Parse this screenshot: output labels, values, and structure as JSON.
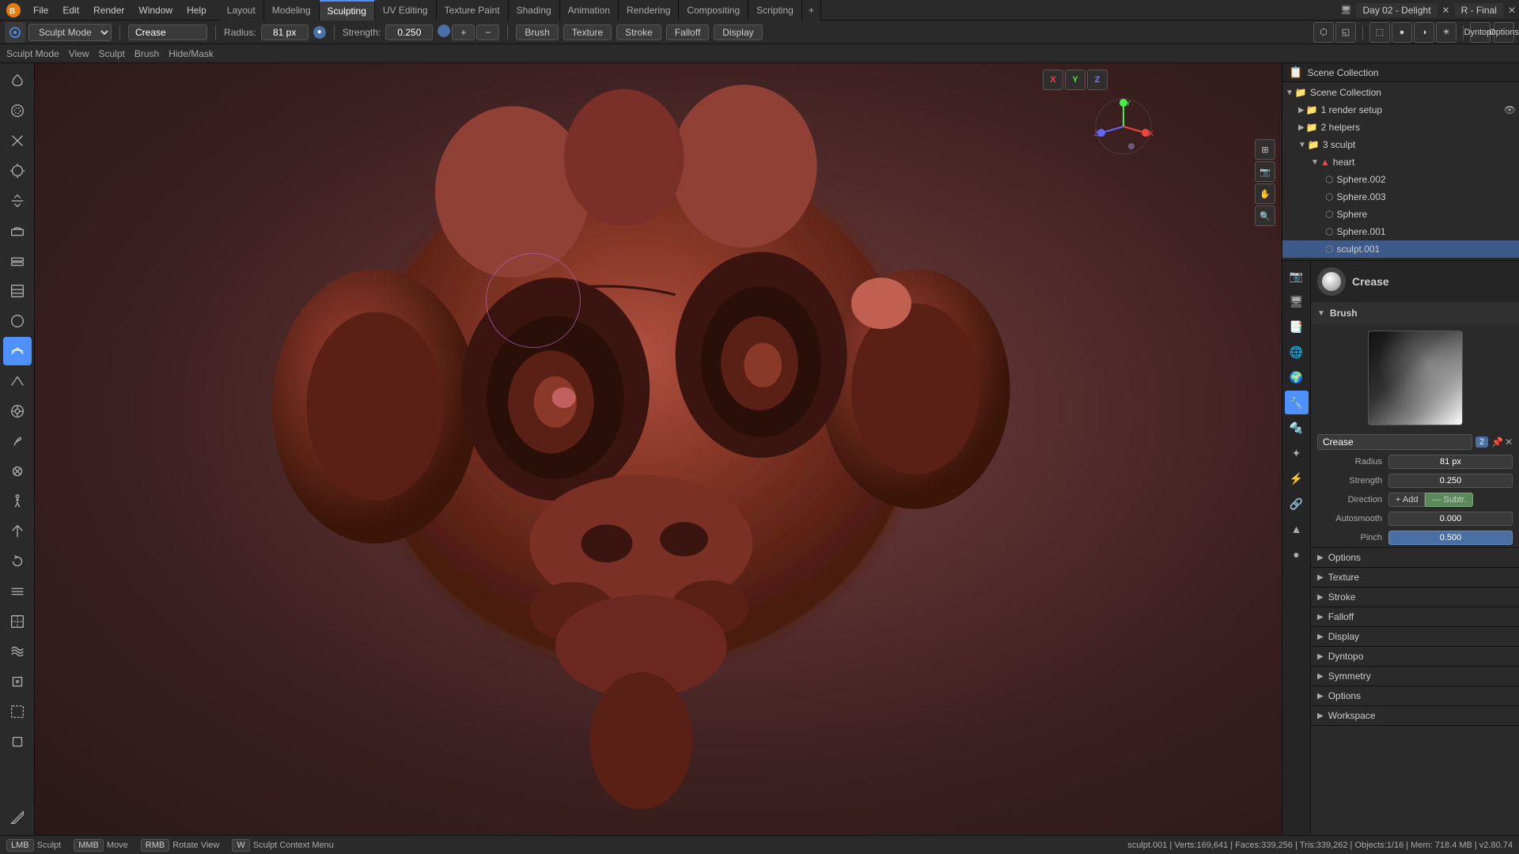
{
  "app": {
    "title": "Blender",
    "file": "Day 02 - Delight",
    "scene": "R - Final"
  },
  "menu": {
    "items": [
      "File",
      "Edit",
      "Render",
      "Window",
      "Help"
    ]
  },
  "workspaces": {
    "tabs": [
      "Layout",
      "Modeling",
      "Sculpting",
      "UV Editing",
      "Texture Paint",
      "Shading",
      "Animation",
      "Rendering",
      "Compositing",
      "Scripting"
    ],
    "active": "Sculpting"
  },
  "toolbar": {
    "mode": "Sculpt Mode",
    "brush_name": "Crease",
    "radius_label": "Radius:",
    "radius_value": "81 px",
    "strength_label": "Strength:",
    "strength_value": "0.250",
    "brush_btn": "Brush",
    "texture_btn": "Texture",
    "stroke_btn": "Stroke",
    "falloff_btn": "Falloff",
    "display_btn": "Display"
  },
  "sub_menu": {
    "items": [
      "Sculpt Mode",
      "View",
      "Sculpt",
      "Brush",
      "Hide/Mask"
    ]
  },
  "tools": [
    {
      "name": "grab",
      "icon": "↗",
      "title": "Draw"
    },
    {
      "name": "smooth",
      "icon": "⊙",
      "title": "Smooth"
    },
    {
      "name": "pinch",
      "icon": "✦",
      "title": "Pinch"
    },
    {
      "name": "inflate",
      "icon": "◎",
      "title": "Inflate"
    },
    {
      "name": "flatten",
      "icon": "⬡",
      "title": "Flatten"
    },
    {
      "name": "clay",
      "icon": "▣",
      "title": "Clay"
    },
    {
      "name": "clay-strips",
      "icon": "▤",
      "title": "Clay Strips"
    },
    {
      "name": "layer",
      "icon": "⬛",
      "title": "Layer"
    },
    {
      "name": "blob",
      "icon": "●",
      "title": "Blob"
    },
    {
      "name": "crease-tool",
      "icon": "⌒",
      "title": "Crease",
      "active": true
    },
    {
      "name": "draw-sharp",
      "icon": "△",
      "title": "Draw Sharp"
    },
    {
      "name": "elastic",
      "icon": "⊕",
      "title": "Elastic"
    },
    {
      "name": "snake-hook",
      "icon": "⤷",
      "title": "Snake Hook"
    },
    {
      "name": "thumb",
      "icon": "◐",
      "title": "Thumb"
    },
    {
      "name": "pose",
      "icon": "✋",
      "title": "Pose"
    },
    {
      "name": "nudge",
      "icon": "➤",
      "title": "Nudge"
    },
    {
      "name": "rotate-tool",
      "icon": "↺",
      "title": "Rotate"
    },
    {
      "name": "slide-relax",
      "icon": "≋",
      "title": "Slide Relax"
    },
    {
      "name": "boundary",
      "icon": "⊟",
      "title": "Boundary"
    },
    {
      "name": "cloth",
      "icon": "≈",
      "title": "Cloth"
    },
    {
      "name": "simplify",
      "icon": "◇",
      "title": "Simplify"
    },
    {
      "name": "mask-tool",
      "icon": "◩",
      "title": "Mask"
    },
    {
      "name": "box-mask",
      "icon": "▭",
      "title": "Box Mask"
    },
    {
      "name": "annotate",
      "icon": "✏",
      "title": "Annotate"
    }
  ],
  "outliner": {
    "title": "Scene Collection",
    "items": [
      {
        "id": "scene-collection",
        "label": "Scene Collection",
        "indent": 0,
        "expanded": true,
        "icon": "📁"
      },
      {
        "id": "render-setup",
        "label": "1 render setup",
        "indent": 1,
        "expanded": false,
        "icon": "📁"
      },
      {
        "id": "helpers",
        "label": "2 helpers",
        "indent": 1,
        "expanded": false,
        "icon": "📁"
      },
      {
        "id": "sculpt",
        "label": "3 sculpt",
        "indent": 1,
        "expanded": true,
        "icon": "📁"
      },
      {
        "id": "heart",
        "label": "heart",
        "indent": 2,
        "expanded": true,
        "icon": "🔺"
      },
      {
        "id": "sphere-002",
        "label": "Sphere.002",
        "indent": 3,
        "expanded": false,
        "icon": "⬡"
      },
      {
        "id": "sphere-003",
        "label": "Sphere.003",
        "indent": 3,
        "expanded": false,
        "icon": "⬡"
      },
      {
        "id": "sphere",
        "label": "Sphere",
        "indent": 3,
        "expanded": false,
        "icon": "⬡"
      },
      {
        "id": "sphere-001",
        "label": "Sphere.001",
        "indent": 3,
        "expanded": false,
        "icon": "⬡"
      },
      {
        "id": "sculpt-001",
        "label": "sculpt.001",
        "indent": 3,
        "expanded": false,
        "icon": "⬡",
        "selected": true
      }
    ]
  },
  "brush_props": {
    "title": "Crease",
    "brush_section": "Brush",
    "brush_name_label": "Crease",
    "brush_num": "2",
    "radius_label": "Radius",
    "radius_value": "81 px",
    "strength_label": "Strength",
    "strength_value": "0.250",
    "direction_label": "Direction",
    "direction_add": "+ Add",
    "direction_sub": "— Subtr.",
    "autosmooth_label": "Autosmooth",
    "autosmooth_value": "0.000",
    "pinch_label": "Pinch",
    "pinch_value": "0.500"
  },
  "collapsibles": [
    {
      "id": "options",
      "label": "Options",
      "expanded": false
    },
    {
      "id": "texture",
      "label": "Texture",
      "expanded": false
    },
    {
      "id": "stroke",
      "label": "Stroke",
      "expanded": false
    },
    {
      "id": "falloff",
      "label": "Falloff",
      "expanded": false
    },
    {
      "id": "display",
      "label": "Display",
      "expanded": false
    },
    {
      "id": "dyntopo",
      "label": "Dyntopo",
      "expanded": false
    },
    {
      "id": "symmetry",
      "label": "Symmetry",
      "expanded": false
    },
    {
      "id": "options2",
      "label": "Options",
      "expanded": false
    },
    {
      "id": "workspace",
      "label": "Workspace",
      "expanded": false
    }
  ],
  "status_bar": {
    "sculpt_label": "Sculpt",
    "move_label": "Move",
    "rotate_label": "Rotate View",
    "context_menu_label": "Sculpt Context Menu",
    "stats": "sculpt.001 | Verts:169,641 | Faces:339,256 | Tris:339,262 | Objects:1/16 | Mem: 718.4 MB | v2.80.74"
  },
  "viewport": {
    "dyntopo": "Dyntopo",
    "options_btn": "Options",
    "axis_x": "X",
    "axis_y": "Y",
    "axis_z": "Z"
  }
}
